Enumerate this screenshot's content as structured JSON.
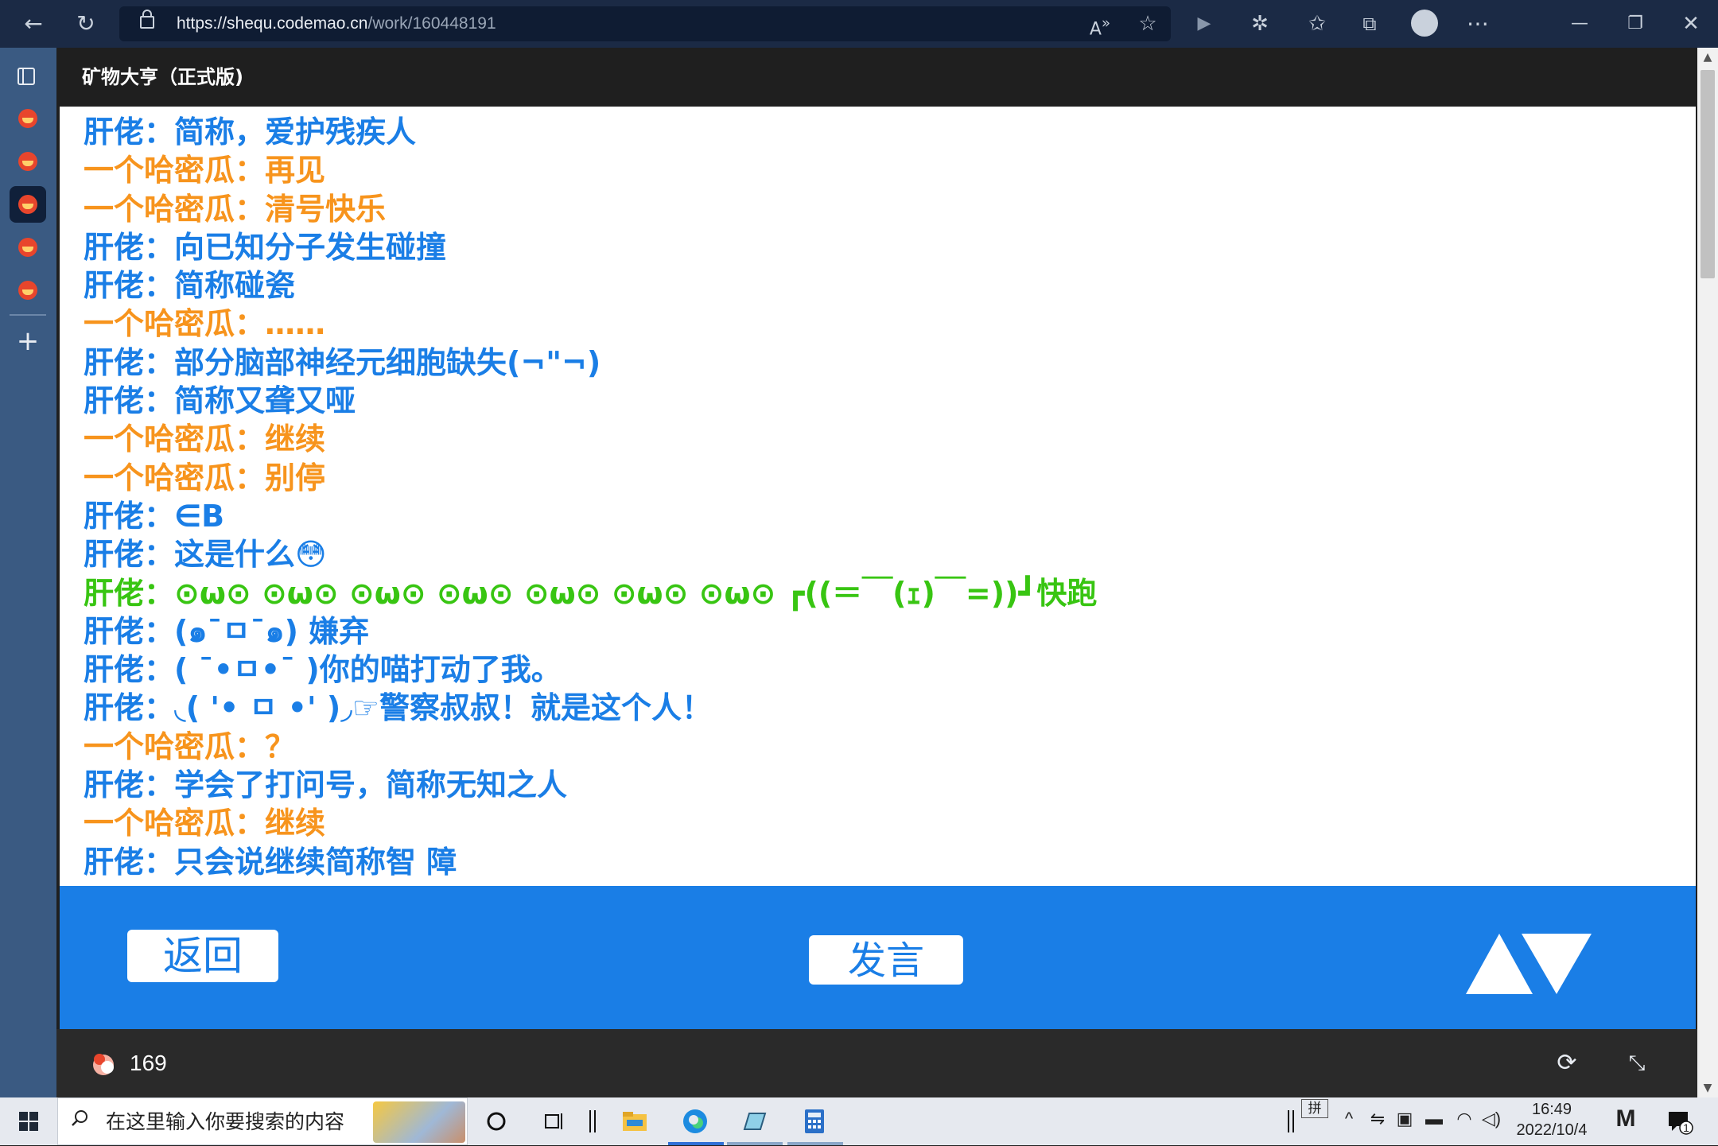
{
  "browser": {
    "url_host": "https://shequ.codemao.cn",
    "url_path": "/work/160448191"
  },
  "page": {
    "title": "矿物大亨（正式版)"
  },
  "chat": [
    {
      "speaker": "肝佬：",
      "text": "简称，爱护残疾人",
      "color": "#1a7ee6"
    },
    {
      "speaker": "一个哈密瓜：",
      "text": "再见",
      "color": "#f7941d"
    },
    {
      "speaker": "一个哈密瓜：",
      "text": "清号快乐",
      "color": "#f7941d"
    },
    {
      "speaker": "肝佬：",
      "text": "向已知分子发生碰撞",
      "color": "#1a7ee6"
    },
    {
      "speaker": "肝佬：",
      "text": "简称碰瓷",
      "color": "#1a7ee6"
    },
    {
      "speaker": "一个哈密瓜：",
      "text": "……",
      "color": "#f7941d"
    },
    {
      "speaker": "肝佬：",
      "text": "部分脑部神经元细胞缺失(¬\"¬)",
      "color": "#1a7ee6"
    },
    {
      "speaker": "肝佬：",
      "text": "简称又聋又哑",
      "color": "#1a7ee6"
    },
    {
      "speaker": "一个哈密瓜：",
      "text": "继续",
      "color": "#f7941d"
    },
    {
      "speaker": "一个哈密瓜：",
      "text": "别停",
      "color": "#f7941d"
    },
    {
      "speaker": "肝佬：",
      "text": "∈B",
      "color": "#1a7ee6"
    },
    {
      "speaker": "肝佬：",
      "text": "这是什么😳",
      "color": "#1a7ee6"
    },
    {
      "speaker": "肝佬：",
      "text": "⊙ω⊙ ⊙ω⊙ ⊙ω⊙ ⊙ω⊙ ⊙ω⊙ ⊙ω⊙ ⊙ω⊙ ┏((＝￣(ｪ)￣=))┛快跑",
      "color": "#38c512"
    },
    {
      "speaker": "肝佬：",
      "text": "(๑¯ㅁ¯๑) 嫌弃",
      "color": "#1a7ee6"
    },
    {
      "speaker": "肝佬：",
      "text": "( ¯•ㅁ•¯ )你的喵打动了我。",
      "color": "#1a7ee6"
    },
    {
      "speaker": "肝佬：",
      "text": "◟( '• ㅁ •' )◞☞警察叔叔！就是这个人！",
      "color": "#1a7ee6"
    },
    {
      "speaker": "一个哈密瓜：",
      "text": "？",
      "color": "#f7941d"
    },
    {
      "speaker": "肝佬：",
      "text": "学会了打问号，简称无知之人",
      "color": "#1a7ee6"
    },
    {
      "speaker": "一个哈密瓜：",
      "text": "继续",
      "color": "#f7941d"
    },
    {
      "speaker": "肝佬：",
      "text": "只会说继续简称智 障",
      "color": "#1a7ee6"
    }
  ],
  "controls": {
    "back_label": "返回",
    "speak_label": "发言"
  },
  "footer": {
    "like_count": "169"
  },
  "taskbar": {
    "search_placeholder": "在这里输入你要搜索的内容",
    "ime_label": "拼",
    "time": "16:49",
    "date": "2022/10/4",
    "notification_count": "1"
  }
}
